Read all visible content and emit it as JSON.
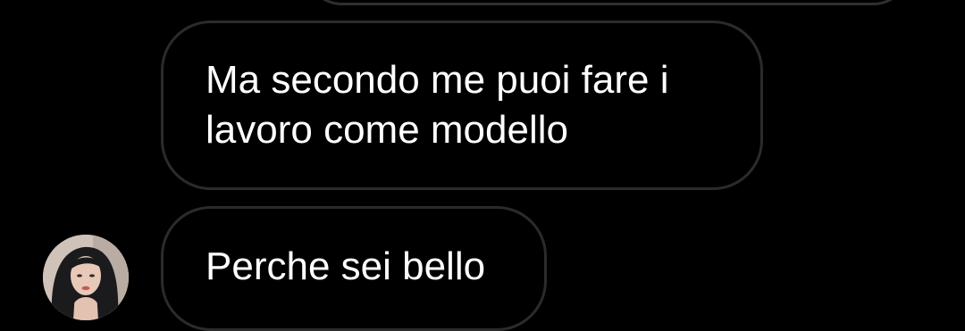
{
  "thread": {
    "messages": [
      {
        "text": "Ma secondo me puoi fare i\nlavoro come modello"
      },
      {
        "text": "Perche sei bello"
      }
    ]
  },
  "avatar": {
    "icon": "profile-photo-avatar"
  },
  "colors": {
    "background": "#000000",
    "bubble_border": "#2b2b2b",
    "text": "#ffffff"
  }
}
